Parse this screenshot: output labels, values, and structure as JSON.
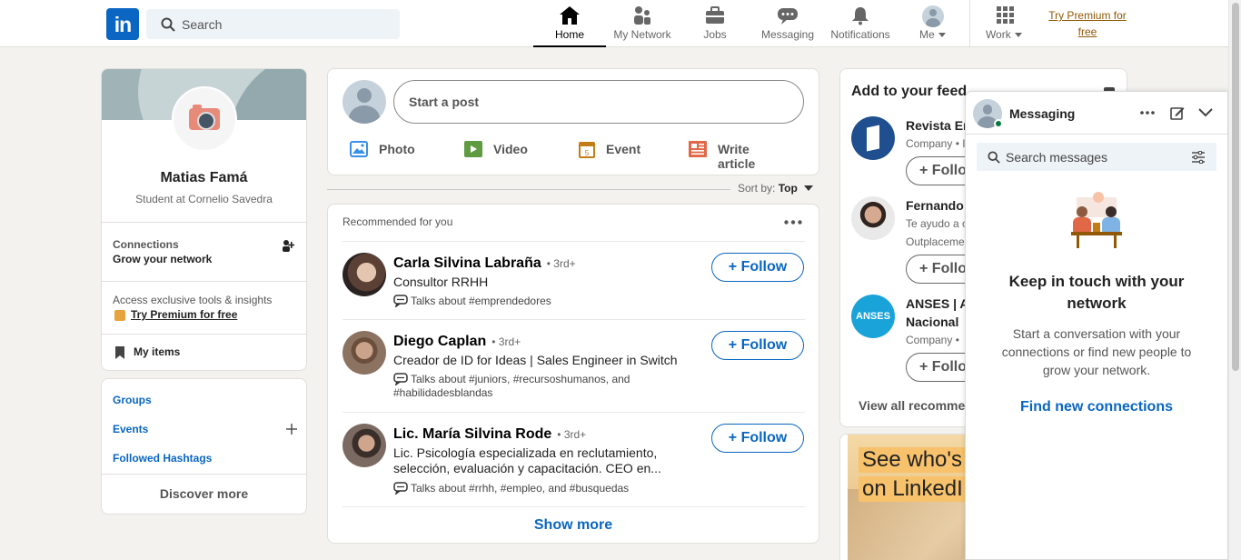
{
  "brand": {
    "logo_text": "in",
    "accent": "#0a66c2",
    "premium_color": "#915907"
  },
  "search": {
    "placeholder": "Search"
  },
  "nav": {
    "home": "Home",
    "network": "My Network",
    "jobs": "Jobs",
    "messaging": "Messaging",
    "notifications": "Notifications",
    "me": "Me",
    "work": "Work",
    "premium": "Try Premium for free"
  },
  "profile": {
    "name": "Matias Famá",
    "headline": "Student at Cornelio Savedra",
    "connections_title": "Connections",
    "connections_sub": "Grow your network",
    "premium_text": "Access exclusive tools & insights",
    "premium_link": "Try Premium for free",
    "my_items": "My items"
  },
  "links": {
    "groups": "Groups",
    "events": "Events",
    "hashtags": "Followed Hashtags",
    "discover": "Discover more"
  },
  "composer": {
    "placeholder": "Start a post",
    "photo": "Photo",
    "video": "Video",
    "event": "Event",
    "article": "Write article"
  },
  "sort": {
    "label": "Sort by:",
    "value": "Top"
  },
  "recommended": {
    "title": "Recommended for you",
    "follow_label": "Follow",
    "show_more": "Show more",
    "people": [
      {
        "name": "Carla Silvina Labraña",
        "degree": "• 3rd+",
        "headline": "Consultor RRHH",
        "talks": "Talks about #emprendedores"
      },
      {
        "name": "Diego Caplan",
        "degree": "• 3rd+",
        "headline": "Creador de ID for Ideas | Sales Engineer in Switch",
        "talks": "Talks about #juniors, #recursoshumanos, and #habilidadesblandas"
      },
      {
        "name": "Lic. María Silvina Rode",
        "degree": "• 3rd+",
        "headline": "Lic. Psicología especializada en reclutamiento, selección, evaluación y capacitación. CEO en...",
        "talks": "Talks about #rrhh, #empleo, and #busquedas"
      }
    ]
  },
  "feed_suggest": {
    "title": "Add to your feed",
    "items": [
      {
        "name": "Revista Er",
        "sub": "Company • I",
        "follow": "Follo"
      },
      {
        "name": "Fernando",
        "sub": "Te ayudo a c",
        "sub2": "Outplaceme",
        "follow": "Follo"
      },
      {
        "name": "ANSES | A",
        "name2": "Nacional",
        "sub": "Company •",
        "follow": "Follo",
        "logo": "ANSES"
      }
    ],
    "view_all": "View all recomme"
  },
  "ad": {
    "line1": "See who's",
    "line2": "on LinkedI"
  },
  "messaging": {
    "title": "Messaging",
    "search_placeholder": "Search messages",
    "empty_title": "Keep in touch with your network",
    "empty_text": "Start a conversation with your connections or find new people to grow your network.",
    "cta": "Find new connections"
  }
}
